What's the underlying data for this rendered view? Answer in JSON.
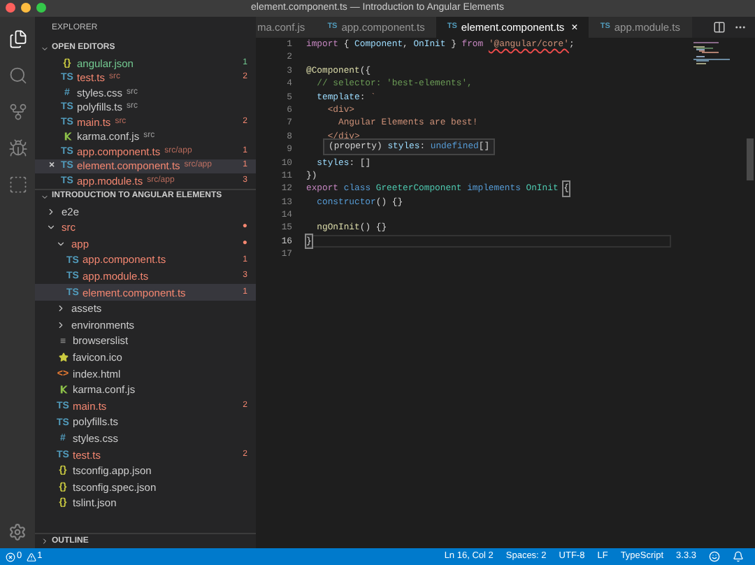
{
  "window": {
    "title": "element.component.ts — Introduction to Angular Elements"
  },
  "activity_bar": [
    {
      "kind": "files",
      "selected": true
    },
    {
      "kind": "search",
      "selected": false
    },
    {
      "kind": "git",
      "selected": false
    },
    {
      "kind": "debug",
      "selected": false
    },
    {
      "kind": "extensions",
      "selected": false
    }
  ],
  "sidebar": {
    "title": "EXPLORER",
    "open_editors": {
      "title": "OPEN EDITORS",
      "expanded": true,
      "items": [
        {
          "icon": {
            "kind": "glyph",
            "text": "{}",
            "color": "#cbcb41"
          },
          "name": "angular.json",
          "badge": "1",
          "color": "#73c991",
          "selected": false
        },
        {
          "icon": {
            "kind": "glyph",
            "text": "TS",
            "color": "#519aba"
          },
          "name": "test.ts",
          "path": "src",
          "badge": "2",
          "color": "#f48771",
          "selected": false
        },
        {
          "icon": {
            "kind": "glyph",
            "text": "#",
            "color": "#519aba"
          },
          "name": "styles.css",
          "path": "src",
          "color": "#cccccc",
          "selected": false
        },
        {
          "icon": {
            "kind": "glyph",
            "text": "TS",
            "color": "#519aba"
          },
          "name": "polyfills.ts",
          "path": "src",
          "color": "#cccccc",
          "selected": false
        },
        {
          "icon": {
            "kind": "glyph",
            "text": "TS",
            "color": "#519aba"
          },
          "name": "main.ts",
          "path": "src",
          "badge": "2",
          "color": "#f48771",
          "selected": false
        },
        {
          "icon": {
            "kind": "karma",
            "color": "#8dc149"
          },
          "name": "karma.conf.js",
          "path": "src",
          "color": "#cccccc",
          "selected": false
        },
        {
          "icon": {
            "kind": "glyph",
            "text": "TS",
            "color": "#519aba"
          },
          "name": "app.component.ts",
          "path": "src/app",
          "badge": "1",
          "color": "#f48771",
          "selected": false
        },
        {
          "icon": {
            "kind": "glyph",
            "text": "TS",
            "color": "#519aba"
          },
          "name": "element.component.ts",
          "path": "src/app",
          "badge": "1",
          "color": "#f48771",
          "selected": true,
          "close": "×"
        },
        {
          "icon": {
            "kind": "glyph",
            "text": "TS",
            "color": "#519aba"
          },
          "name": "app.module.ts",
          "path": "src/app",
          "badge": "3",
          "color": "#f48771",
          "selected": false
        }
      ]
    },
    "project": {
      "title": "INTRODUCTION TO ANGULAR ELEMENTS",
      "expanded": true,
      "children": [
        {
          "kind": "folder",
          "name": "e2e",
          "expanded": false,
          "color": "#cccccc"
        },
        {
          "kind": "folder",
          "name": "src",
          "expanded": true,
          "color": "#f48771",
          "badge": "●",
          "children": [
            {
              "kind": "folder",
              "name": "app",
              "expanded": true,
              "color": "#f48771",
              "badge": "●",
              "children": [
                {
                  "kind": "file",
                  "icon": {
                    "kind": "glyph",
                    "text": "TS",
                    "color": "#519aba"
                  },
                  "name": "app.component.ts",
                  "color": "#f48771",
                  "badge": "1",
                  "selected": false
                },
                {
                  "kind": "file",
                  "icon": {
                    "kind": "glyph",
                    "text": "TS",
                    "color": "#519aba"
                  },
                  "name": "app.module.ts",
                  "color": "#f48771",
                  "badge": "3",
                  "selected": false
                },
                {
                  "kind": "file",
                  "icon": {
                    "kind": "glyph",
                    "text": "TS",
                    "color": "#519aba"
                  },
                  "name": "element.component.ts",
                  "color": "#f48771",
                  "badge": "1",
                  "selected": true
                }
              ]
            },
            {
              "kind": "folder",
              "name": "assets",
              "expanded": false,
              "color": "#cccccc"
            },
            {
              "kind": "folder",
              "name": "environments",
              "expanded": false,
              "color": "#cccccc"
            },
            {
              "kind": "file",
              "icon": {
                "kind": "glyph",
                "text": "≡",
                "color": "#a0a0a0"
              },
              "name": "browserslist",
              "color": "#cccccc",
              "selected": false
            },
            {
              "kind": "file",
              "icon": {
                "kind": "star",
                "color": "#cbcb41"
              },
              "name": "favicon.ico",
              "color": "#cccccc",
              "selected": false
            },
            {
              "kind": "file",
              "icon": {
                "kind": "glyph",
                "text": "<>",
                "color": "#e37933"
              },
              "name": "index.html",
              "color": "#cccccc",
              "selected": false
            },
            {
              "kind": "file",
              "icon": {
                "kind": "karma",
                "color": "#8dc149"
              },
              "name": "karma.conf.js",
              "color": "#cccccc",
              "selected": false
            },
            {
              "kind": "file",
              "icon": {
                "kind": "glyph",
                "text": "TS",
                "color": "#519aba"
              },
              "name": "main.ts",
              "color": "#f48771",
              "badge": "2",
              "selected": false
            },
            {
              "kind": "file",
              "icon": {
                "kind": "glyph",
                "text": "TS",
                "color": "#519aba"
              },
              "name": "polyfills.ts",
              "color": "#cccccc",
              "selected": false
            },
            {
              "kind": "file",
              "icon": {
                "kind": "glyph",
                "text": "#",
                "color": "#519aba"
              },
              "name": "styles.css",
              "color": "#cccccc",
              "selected": false
            },
            {
              "kind": "file",
              "icon": {
                "kind": "glyph",
                "text": "TS",
                "color": "#519aba"
              },
              "name": "test.ts",
              "color": "#f48771",
              "badge": "2",
              "selected": false
            },
            {
              "kind": "file",
              "icon": {
                "kind": "glyph",
                "text": "{}",
                "color": "#cbcb41"
              },
              "name": "tsconfig.app.json",
              "color": "#cccccc",
              "selected": false
            },
            {
              "kind": "file",
              "icon": {
                "kind": "glyph",
                "text": "{}",
                "color": "#cbcb41"
              },
              "name": "tsconfig.spec.json",
              "color": "#cccccc",
              "selected": false
            },
            {
              "kind": "file",
              "icon": {
                "kind": "glyph",
                "text": "{}",
                "color": "#cbcb41"
              },
              "name": "tslint.json",
              "color": "#cccccc",
              "selected": false
            }
          ]
        }
      ]
    },
    "outline": {
      "title": "OUTLINE",
      "expanded": false
    }
  },
  "tabs": [
    {
      "label": "ma.conf.js",
      "selected": false
    },
    {
      "icon": "TS",
      "label": "app.component.ts",
      "selected": false
    },
    {
      "icon": "TS",
      "label": "element.component.ts",
      "selected": true,
      "close": "×"
    },
    {
      "icon": "TS",
      "label": "app.module.ts",
      "selected": false
    }
  ],
  "editor": {
    "lines": [
      {
        "number": "1",
        "current": false,
        "tokens": [
          {
            "text": "import",
            "kind": "keyword"
          },
          {
            "text": " { ",
            "kind": "punct"
          },
          {
            "text": "Component",
            "kind": "variable"
          },
          {
            "text": ", ",
            "kind": "punct"
          },
          {
            "text": "OnInit",
            "kind": "variable"
          },
          {
            "text": " } ",
            "kind": "punct"
          },
          {
            "text": "from ",
            "kind": "keyword"
          },
          {
            "text": "'@angular/core'",
            "kind": "error_string"
          },
          {
            "text": ";",
            "kind": "punct"
          }
        ]
      },
      {
        "number": "2",
        "current": false
      },
      {
        "number": "3",
        "current": false,
        "tokens": [
          {
            "text": "@Component",
            "kind": "decorator"
          },
          {
            "text": "({",
            "kind": "punct"
          }
        ]
      },
      {
        "number": "4",
        "current": false,
        "tokens": [
          {
            "text": "  // selector: 'best-elements',",
            "kind": "comment"
          }
        ]
      },
      {
        "number": "5",
        "current": false,
        "tokens": [
          {
            "text": "  template",
            "kind": "variable"
          },
          {
            "text": ": ",
            "kind": "punct"
          },
          {
            "text": "`",
            "kind": "string"
          }
        ]
      },
      {
        "number": "6",
        "current": false,
        "tokens": [
          {
            "text": "    <div>",
            "kind": "string"
          }
        ]
      },
      {
        "number": "7",
        "current": false,
        "tokens": [
          {
            "text": "      Angular Elements are best!",
            "kind": "string"
          }
        ]
      },
      {
        "number": "8",
        "current": false,
        "tokens": [
          {
            "text": "    </div>",
            "kind": "string"
          }
        ]
      },
      {
        "number": "9",
        "current": false
      },
      {
        "number": "10",
        "current": false,
        "tokens": [
          {
            "text": "  styles",
            "kind": "variable"
          },
          {
            "text": ": []",
            "kind": "punct"
          }
        ]
      },
      {
        "number": "11",
        "current": false,
        "tokens": [
          {
            "text": "})",
            "kind": "punct"
          }
        ]
      },
      {
        "number": "12",
        "current": false,
        "tokens": [
          {
            "text": "export ",
            "kind": "keyword"
          },
          {
            "text": "class ",
            "kind": "storage"
          },
          {
            "text": "GreeterComponent ",
            "kind": "type"
          },
          {
            "text": "implements ",
            "kind": "storage"
          },
          {
            "text": "OnInit ",
            "kind": "type"
          },
          {
            "text": "{",
            "kind": "bracket_match"
          }
        ]
      },
      {
        "number": "13",
        "current": false,
        "tokens": [
          {
            "text": "  constructor",
            "kind": "storage"
          },
          {
            "text": "() {}",
            "kind": "punct"
          }
        ]
      },
      {
        "number": "14",
        "current": false
      },
      {
        "number": "15",
        "current": false,
        "tokens": [
          {
            "text": "  ngOnInit",
            "kind": "function"
          },
          {
            "text": "() {}",
            "kind": "punct"
          }
        ]
      },
      {
        "number": "16",
        "current": true,
        "tokens": [
          {
            "text": "}",
            "kind": "bracket_match"
          }
        ]
      },
      {
        "number": "17",
        "current": false
      }
    ],
    "hover": {
      "tokens": [
        {
          "text": "(property) ",
          "kind": "punct"
        },
        {
          "text": "styles",
          "kind": "variable"
        },
        {
          "text": ": ",
          "kind": "punct"
        },
        {
          "text": "undefined",
          "kind": "storage"
        },
        {
          "text": "[]",
          "kind": "punct"
        }
      ]
    }
  },
  "status_bar": {
    "errors": "0",
    "warnings": "1",
    "items": [
      "Ln 16, Col 2",
      "Spaces: 2",
      "UTF-8",
      "LF",
      "TypeScript",
      "3.3.3"
    ]
  }
}
